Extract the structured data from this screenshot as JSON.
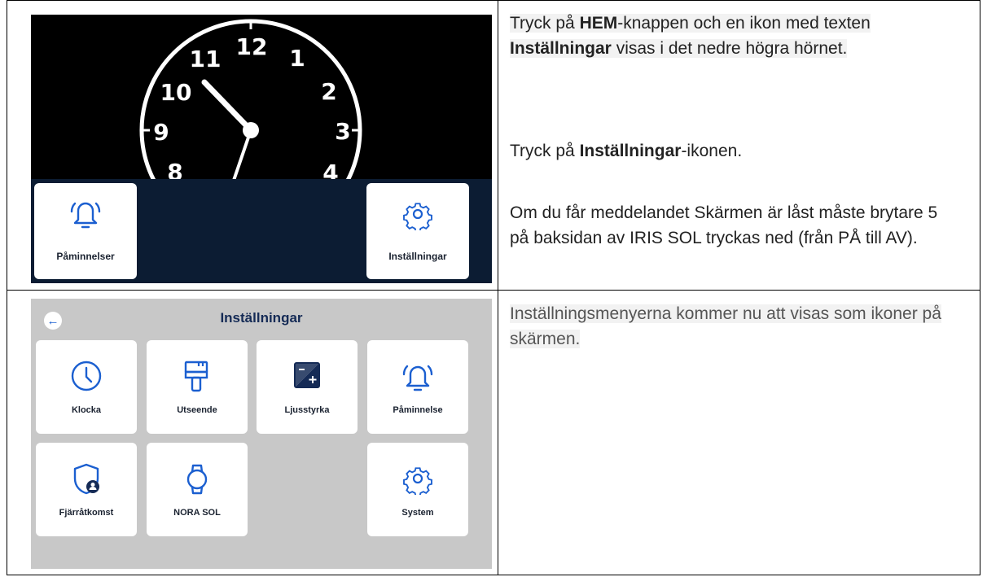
{
  "row1": {
    "shot": {
      "clock_numbers": [
        "12",
        "1",
        "2",
        "3",
        "4",
        "8",
        "9",
        "10",
        "11"
      ],
      "dock_left_label": "Påminnelser",
      "dock_right_label": "Inställningar",
      "colors": {
        "screen_bg": "#000000",
        "dock_bg": "#0c1c33",
        "icon_blue": "#1b5fd0"
      }
    },
    "p1": {
      "a": "Tryck på ",
      "b": "HEM",
      "c": "-knappen och en ikon med texten ",
      "d": "Inställningar",
      "e": " visas i det nedre högra hörnet."
    },
    "p2": {
      "a": "Tryck på ",
      "b": "Inställningar",
      "c": "-ikonen."
    },
    "p3": {
      "text": "Om du får meddelandet Skärmen är låst måste brytare 5 på baksidan av IRIS SOL tryckas ned (från PÅ till AV)."
    }
  },
  "row2": {
    "shot": {
      "title": "Inställningar",
      "back_icon": "arrow-left-icon",
      "tiles": [
        {
          "label": "Klocka",
          "icon": "clock-icon"
        },
        {
          "label": "Utseende",
          "icon": "paint-roller-icon"
        },
        {
          "label": "Ljusstyrka",
          "icon": "brightness-icon"
        },
        {
          "label": "Påminnelse",
          "icon": "bell-icon"
        },
        {
          "label": "Fjärråtkomst",
          "icon": "shield-user-icon"
        },
        {
          "label": "NORA SOL",
          "icon": "watch-icon"
        },
        {
          "label": "System",
          "icon": "gear-icon"
        }
      ]
    },
    "p1": {
      "text": "Inställningsmenyerna kommer nu att visas som ikoner på skärmen."
    }
  }
}
